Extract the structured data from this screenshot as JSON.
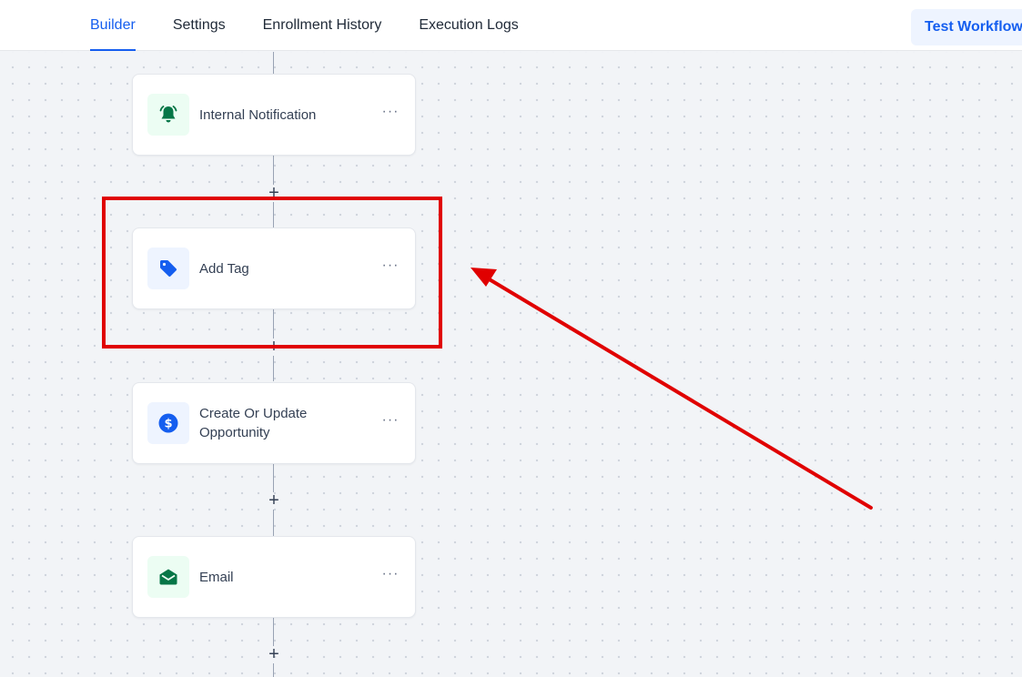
{
  "tabs": [
    {
      "label": "Builder",
      "active": true
    },
    {
      "label": "Settings",
      "active": false
    },
    {
      "label": "Enrollment History",
      "active": false
    },
    {
      "label": "Execution Logs",
      "active": false
    }
  ],
  "test_button": {
    "label": "Test Workflow"
  },
  "nodes": [
    {
      "label": "Internal Notification",
      "icon": "bell-icon",
      "icon_color": "#067647",
      "icon_bg": "#ecfdf3"
    },
    {
      "label": "Add Tag",
      "icon": "tag-icon",
      "icon_color": "#155eef",
      "icon_bg": "#eef4ff"
    },
    {
      "label": "Create Or Update Opportunity",
      "icon": "dollar-icon",
      "icon_color": "#155eef",
      "icon_bg": "#eef4ff"
    },
    {
      "label": "Email",
      "icon": "envelope-icon",
      "icon_color": "#067647",
      "icon_bg": "#ecfdf3"
    }
  ],
  "more_glyph": "···",
  "add_glyph": "+",
  "annotation": {
    "color": "#e00000",
    "highlighted_node": "Add Tag"
  }
}
